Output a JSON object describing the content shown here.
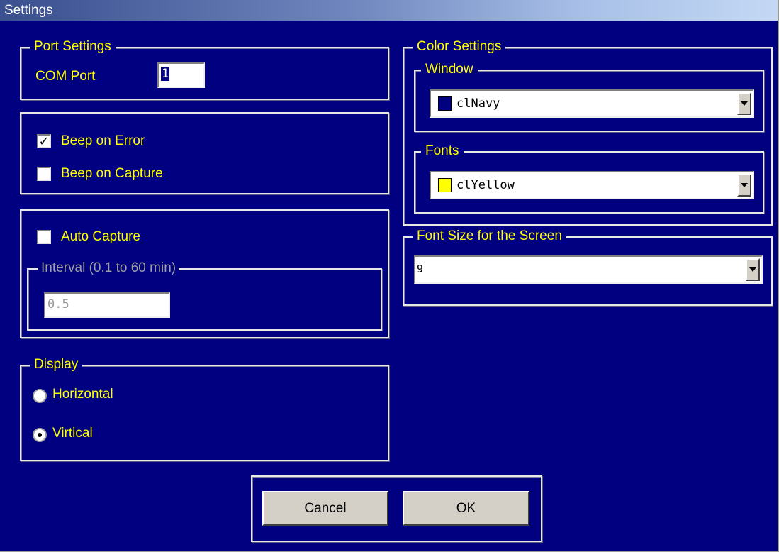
{
  "window": {
    "title": "Settings"
  },
  "port_settings": {
    "legend": "Port Settings",
    "com_port_label": "COM Port",
    "com_port_value": "1"
  },
  "beep": {
    "error": {
      "label": "Beep on Error",
      "checked": true
    },
    "capture": {
      "label": "Beep on Capture",
      "checked": false
    }
  },
  "auto_capture": {
    "label": "Auto Capture",
    "checked": false,
    "interval_legend": "Interval (0.1 to 60 min)",
    "interval_value": "0.5"
  },
  "display": {
    "legend": "Display",
    "options": [
      {
        "label": "Horizontal",
        "selected": false
      },
      {
        "label": "Virtical",
        "selected": true
      }
    ]
  },
  "color_settings": {
    "legend": "Color Settings",
    "window": {
      "legend": "Window",
      "value": "clNavy",
      "swatch_color": "#000080"
    },
    "fonts": {
      "legend": "Fonts",
      "value": "clYellow",
      "swatch_color": "#ffff00"
    }
  },
  "font_size": {
    "legend": "Font Size for the Screen",
    "value": "9"
  },
  "buttons": {
    "cancel": "Cancel",
    "ok": "OK"
  },
  "colors": {
    "background": "#000080",
    "label_text": "#ffff00",
    "disabled_text": "#a0a0a0",
    "button_face": "#d4d0c8"
  }
}
